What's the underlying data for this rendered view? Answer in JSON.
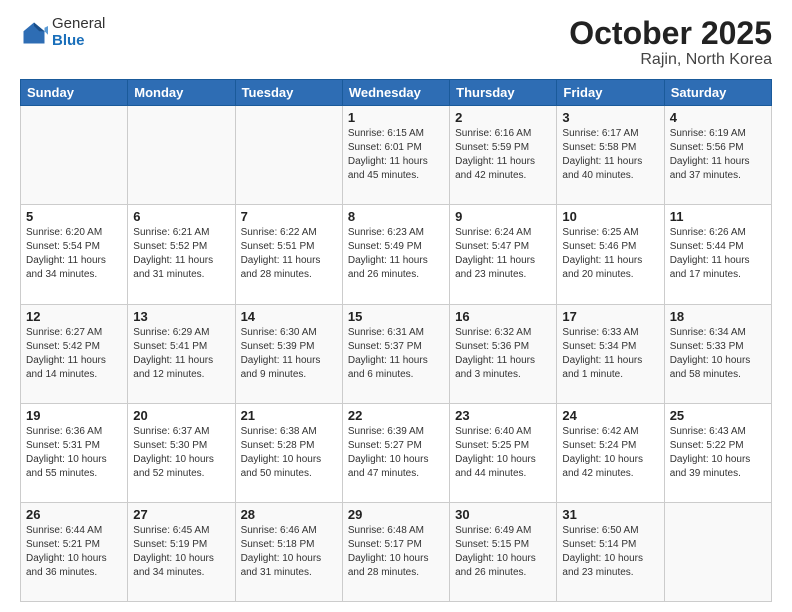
{
  "logo": {
    "general": "General",
    "blue": "Blue"
  },
  "title": "October 2025",
  "subtitle": "Rajin, North Korea",
  "days": [
    "Sunday",
    "Monday",
    "Tuesday",
    "Wednesday",
    "Thursday",
    "Friday",
    "Saturday"
  ],
  "weeks": [
    [
      {
        "date": "",
        "sunrise": "",
        "sunset": "",
        "daylight": ""
      },
      {
        "date": "",
        "sunrise": "",
        "sunset": "",
        "daylight": ""
      },
      {
        "date": "",
        "sunrise": "",
        "sunset": "",
        "daylight": ""
      },
      {
        "date": "1",
        "sunrise": "Sunrise: 6:15 AM",
        "sunset": "Sunset: 6:01 PM",
        "daylight": "Daylight: 11 hours and 45 minutes."
      },
      {
        "date": "2",
        "sunrise": "Sunrise: 6:16 AM",
        "sunset": "Sunset: 5:59 PM",
        "daylight": "Daylight: 11 hours and 42 minutes."
      },
      {
        "date": "3",
        "sunrise": "Sunrise: 6:17 AM",
        "sunset": "Sunset: 5:58 PM",
        "daylight": "Daylight: 11 hours and 40 minutes."
      },
      {
        "date": "4",
        "sunrise": "Sunrise: 6:19 AM",
        "sunset": "Sunset: 5:56 PM",
        "daylight": "Daylight: 11 hours and 37 minutes."
      }
    ],
    [
      {
        "date": "5",
        "sunrise": "Sunrise: 6:20 AM",
        "sunset": "Sunset: 5:54 PM",
        "daylight": "Daylight: 11 hours and 34 minutes."
      },
      {
        "date": "6",
        "sunrise": "Sunrise: 6:21 AM",
        "sunset": "Sunset: 5:52 PM",
        "daylight": "Daylight: 11 hours and 31 minutes."
      },
      {
        "date": "7",
        "sunrise": "Sunrise: 6:22 AM",
        "sunset": "Sunset: 5:51 PM",
        "daylight": "Daylight: 11 hours and 28 minutes."
      },
      {
        "date": "8",
        "sunrise": "Sunrise: 6:23 AM",
        "sunset": "Sunset: 5:49 PM",
        "daylight": "Daylight: 11 hours and 26 minutes."
      },
      {
        "date": "9",
        "sunrise": "Sunrise: 6:24 AM",
        "sunset": "Sunset: 5:47 PM",
        "daylight": "Daylight: 11 hours and 23 minutes."
      },
      {
        "date": "10",
        "sunrise": "Sunrise: 6:25 AM",
        "sunset": "Sunset: 5:46 PM",
        "daylight": "Daylight: 11 hours and 20 minutes."
      },
      {
        "date": "11",
        "sunrise": "Sunrise: 6:26 AM",
        "sunset": "Sunset: 5:44 PM",
        "daylight": "Daylight: 11 hours and 17 minutes."
      }
    ],
    [
      {
        "date": "12",
        "sunrise": "Sunrise: 6:27 AM",
        "sunset": "Sunset: 5:42 PM",
        "daylight": "Daylight: 11 hours and 14 minutes."
      },
      {
        "date": "13",
        "sunrise": "Sunrise: 6:29 AM",
        "sunset": "Sunset: 5:41 PM",
        "daylight": "Daylight: 11 hours and 12 minutes."
      },
      {
        "date": "14",
        "sunrise": "Sunrise: 6:30 AM",
        "sunset": "Sunset: 5:39 PM",
        "daylight": "Daylight: 11 hours and 9 minutes."
      },
      {
        "date": "15",
        "sunrise": "Sunrise: 6:31 AM",
        "sunset": "Sunset: 5:37 PM",
        "daylight": "Daylight: 11 hours and 6 minutes."
      },
      {
        "date": "16",
        "sunrise": "Sunrise: 6:32 AM",
        "sunset": "Sunset: 5:36 PM",
        "daylight": "Daylight: 11 hours and 3 minutes."
      },
      {
        "date": "17",
        "sunrise": "Sunrise: 6:33 AM",
        "sunset": "Sunset: 5:34 PM",
        "daylight": "Daylight: 11 hours and 1 minute."
      },
      {
        "date": "18",
        "sunrise": "Sunrise: 6:34 AM",
        "sunset": "Sunset: 5:33 PM",
        "daylight": "Daylight: 10 hours and 58 minutes."
      }
    ],
    [
      {
        "date": "19",
        "sunrise": "Sunrise: 6:36 AM",
        "sunset": "Sunset: 5:31 PM",
        "daylight": "Daylight: 10 hours and 55 minutes."
      },
      {
        "date": "20",
        "sunrise": "Sunrise: 6:37 AM",
        "sunset": "Sunset: 5:30 PM",
        "daylight": "Daylight: 10 hours and 52 minutes."
      },
      {
        "date": "21",
        "sunrise": "Sunrise: 6:38 AM",
        "sunset": "Sunset: 5:28 PM",
        "daylight": "Daylight: 10 hours and 50 minutes."
      },
      {
        "date": "22",
        "sunrise": "Sunrise: 6:39 AM",
        "sunset": "Sunset: 5:27 PM",
        "daylight": "Daylight: 10 hours and 47 minutes."
      },
      {
        "date": "23",
        "sunrise": "Sunrise: 6:40 AM",
        "sunset": "Sunset: 5:25 PM",
        "daylight": "Daylight: 10 hours and 44 minutes."
      },
      {
        "date": "24",
        "sunrise": "Sunrise: 6:42 AM",
        "sunset": "Sunset: 5:24 PM",
        "daylight": "Daylight: 10 hours and 42 minutes."
      },
      {
        "date": "25",
        "sunrise": "Sunrise: 6:43 AM",
        "sunset": "Sunset: 5:22 PM",
        "daylight": "Daylight: 10 hours and 39 minutes."
      }
    ],
    [
      {
        "date": "26",
        "sunrise": "Sunrise: 6:44 AM",
        "sunset": "Sunset: 5:21 PM",
        "daylight": "Daylight: 10 hours and 36 minutes."
      },
      {
        "date": "27",
        "sunrise": "Sunrise: 6:45 AM",
        "sunset": "Sunset: 5:19 PM",
        "daylight": "Daylight: 10 hours and 34 minutes."
      },
      {
        "date": "28",
        "sunrise": "Sunrise: 6:46 AM",
        "sunset": "Sunset: 5:18 PM",
        "daylight": "Daylight: 10 hours and 31 minutes."
      },
      {
        "date": "29",
        "sunrise": "Sunrise: 6:48 AM",
        "sunset": "Sunset: 5:17 PM",
        "daylight": "Daylight: 10 hours and 28 minutes."
      },
      {
        "date": "30",
        "sunrise": "Sunrise: 6:49 AM",
        "sunset": "Sunset: 5:15 PM",
        "daylight": "Daylight: 10 hours and 26 minutes."
      },
      {
        "date": "31",
        "sunrise": "Sunrise: 6:50 AM",
        "sunset": "Sunset: 5:14 PM",
        "daylight": "Daylight: 10 hours and 23 minutes."
      },
      {
        "date": "",
        "sunrise": "",
        "sunset": "",
        "daylight": ""
      }
    ]
  ]
}
